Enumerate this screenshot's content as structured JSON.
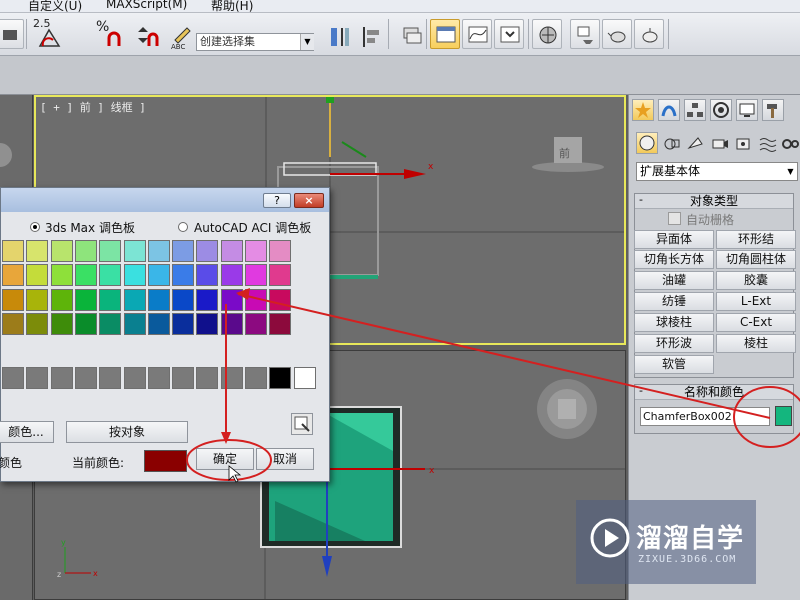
{
  "menu": {
    "items": [
      "自定义(U)",
      "MAXScript(M)",
      "帮助(H)"
    ]
  },
  "toolbar": {
    "selection_set_placeholder": "创建选择集",
    "snap_angle_label": "2.5",
    "snap_percent_label": "%",
    "accent_active": "#f2c95a"
  },
  "viewport": {
    "top_label": "[ + ] 前 ] 线框 ]",
    "nav_cube_label": "前",
    "border_active": "#e8e85a"
  },
  "command_panel": {
    "category_dropdown": "扩展基本体",
    "object_type_header": "对象类型",
    "auto_grid_label": "自动栅格",
    "buttons": [
      "异面体",
      "环形结",
      "切角长方体",
      "切角圆柱体",
      "油罐",
      "胶囊",
      "纺锤",
      "L-Ext",
      "球棱柱",
      "C-Ext",
      "环形波",
      "棱柱",
      "软管"
    ],
    "name_color_header": "名称和颜色",
    "object_name": "ChamferBox002",
    "object_color": "#14b67e"
  },
  "dialog": {
    "help_button": "?",
    "close_button": "×",
    "radio_max_label": "3ds Max 调色板",
    "radio_autocad_label": "AutoCAD ACI 调色板",
    "add_color_button": "颜色...",
    "by_object_button": "按对象",
    "left_label": "颜色",
    "current_color_label": "当前颜色:",
    "current_color": "#8a0000",
    "ok_button": "确定",
    "cancel_button": "取消",
    "palette_rows": [
      [
        "#e4d46c",
        "#d7e46c",
        "#b8e46c",
        "#8ee47c",
        "#7ce4a4",
        "#7ce4d4",
        "#7cc4e4",
        "#7c9ce4",
        "#9c8ce4",
        "#c48ce4",
        "#e48ce4",
        "#e48cc4"
      ],
      [
        "#e8a63a",
        "#c4dc3a",
        "#8ee03a",
        "#3ae064",
        "#3ae0a4",
        "#3ae0e0",
        "#3ab6e8",
        "#3a7ce8",
        "#5a4ce8",
        "#9a3ae8",
        "#e03ae0",
        "#e03a8e"
      ],
      [
        "#c88a0a",
        "#a8b40a",
        "#5eb40a",
        "#0ab43a",
        "#0ab47c",
        "#0aa8b4",
        "#0a7cc8",
        "#0a48c8",
        "#1a1ac8",
        "#7a0ac8",
        "#c80ab4",
        "#c80a5e"
      ],
      [
        "#9c7c1a",
        "#7c8c0a",
        "#3e8c0a",
        "#0a8c2a",
        "#0a8c64",
        "#0a8090",
        "#0a5a9c",
        "#0a2e9c",
        "#10108c",
        "#5a0a8c",
        "#8c0a80",
        "#8c0a3c"
      ]
    ],
    "gray_row": [
      "#7a7a7a",
      "#7a7a7a",
      "#7a7a7a",
      "#7a7a7a",
      "#7a7a7a",
      "#7a7a7a",
      "#7a7a7a",
      "#7a7a7a",
      "#7a7a7a",
      "#7a7a7a",
      "#7a7a7a",
      "#000000",
      "#ffffff"
    ]
  },
  "watermark": {
    "title": "溜溜自学",
    "subtitle": "ZIXUE.3D66.COM"
  }
}
